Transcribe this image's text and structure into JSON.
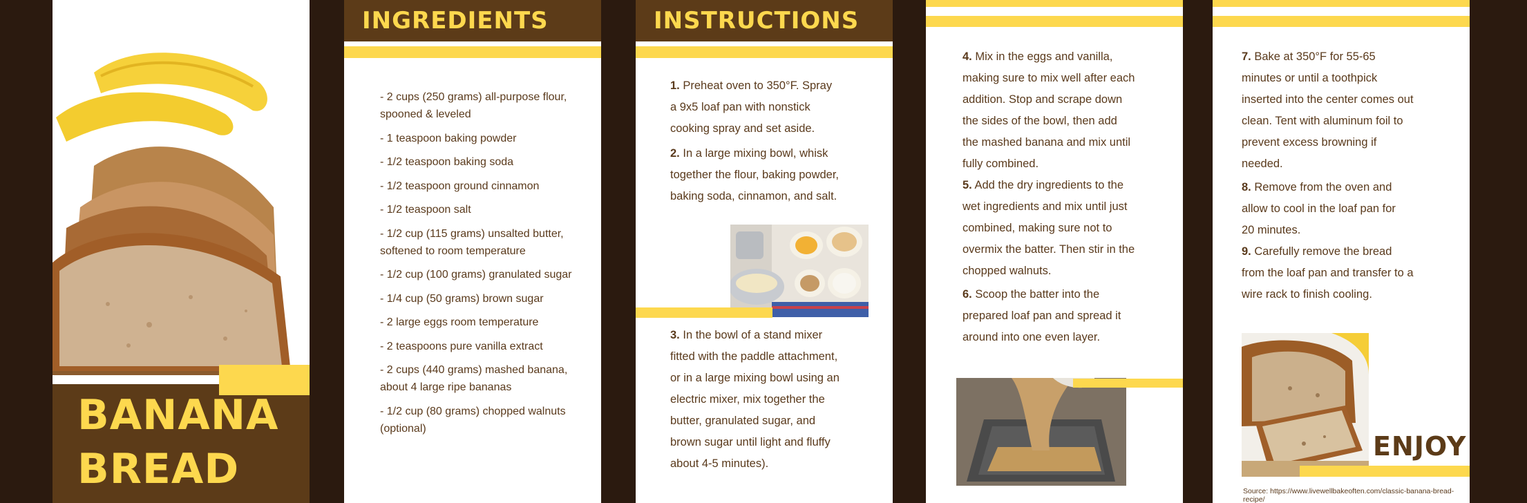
{
  "cover": {
    "title_line1": "BANANA",
    "title_line2": "BREAD"
  },
  "ingredients": {
    "heading": "INGREDIENTS",
    "items": [
      "- 2 cups (250 grams) all-purpose flour, spooned & leveled",
      "- 1 teaspoon baking powder",
      "- 1/2 teaspoon baking soda",
      "- 1/2 teaspoon ground cinnamon",
      "- 1/2 teaspoon salt",
      "- 1/2 cup (115 grams) unsalted butter, softened to room temperature",
      "- 1/2 cup (100 grams) granulated sugar",
      "- 1/4 cup (50 grams) brown sugar",
      "- 2 large eggs room temperature",
      "- 2 teaspoons pure vanilla extract",
      "- 2 cups (440 grams) mashed banana, about 4 large ripe bananas",
      "- 1/2 cup (80 grams) chopped walnuts (optional)"
    ]
  },
  "instructions": {
    "heading": "INSTRUCTIONS",
    "steps": [
      {
        "num": "1.",
        "text": "Preheat oven to 350°F. Spray a 9x5 loaf pan with nonstick cooking spray and set aside."
      },
      {
        "num": "2.",
        "text": "In a large mixing bowl, whisk together the flour, baking powder, baking soda, cinnamon, and salt."
      },
      {
        "num": "3.",
        "text": "In the bowl of a stand mixer fitted with the paddle attachment, or in a large mixing bowl using an electric mixer, mix together the butter, granulated sugar, and brown sugar until light and fluffy about 4-5 minutes)."
      },
      {
        "num": "4.",
        "text": "Mix in the eggs and vanilla, making sure to mix well after each addition. Stop and scrape down the sides of the bowl, then add the mashed banana and mix until fully combined."
      },
      {
        "num": "5.",
        "text": "Add the dry ingredients to the wet ingredients and mix until just combined, making sure not to overmix the batter. Then stir in the chopped walnuts."
      },
      {
        "num": "6.",
        "text": "Scoop the batter into the prepared loaf pan and spread it around into one even layer."
      },
      {
        "num": "7.",
        "text": "Bake at 350°F for 55-65 minutes or until a toothpick inserted into the center comes out clean. Tent with aluminum foil to prevent excess browning if needed."
      },
      {
        "num": "8.",
        "text": "Remove from the oven and allow to cool in the loaf pan for 20 minutes."
      },
      {
        "num": "9.",
        "text": "Carefully remove the bread from the loaf pan and transfer to a wire rack to finish cooling."
      }
    ]
  },
  "closing": {
    "enjoy": "ENJOY!",
    "source": "Source: https://www.livewellbakeoften.com/classic-banana-bread-recipe/"
  },
  "colors": {
    "brown": "#5c3b18",
    "dark": "#2b1a0f",
    "yellow": "#fdd84e",
    "text": "#5a3a1c"
  }
}
